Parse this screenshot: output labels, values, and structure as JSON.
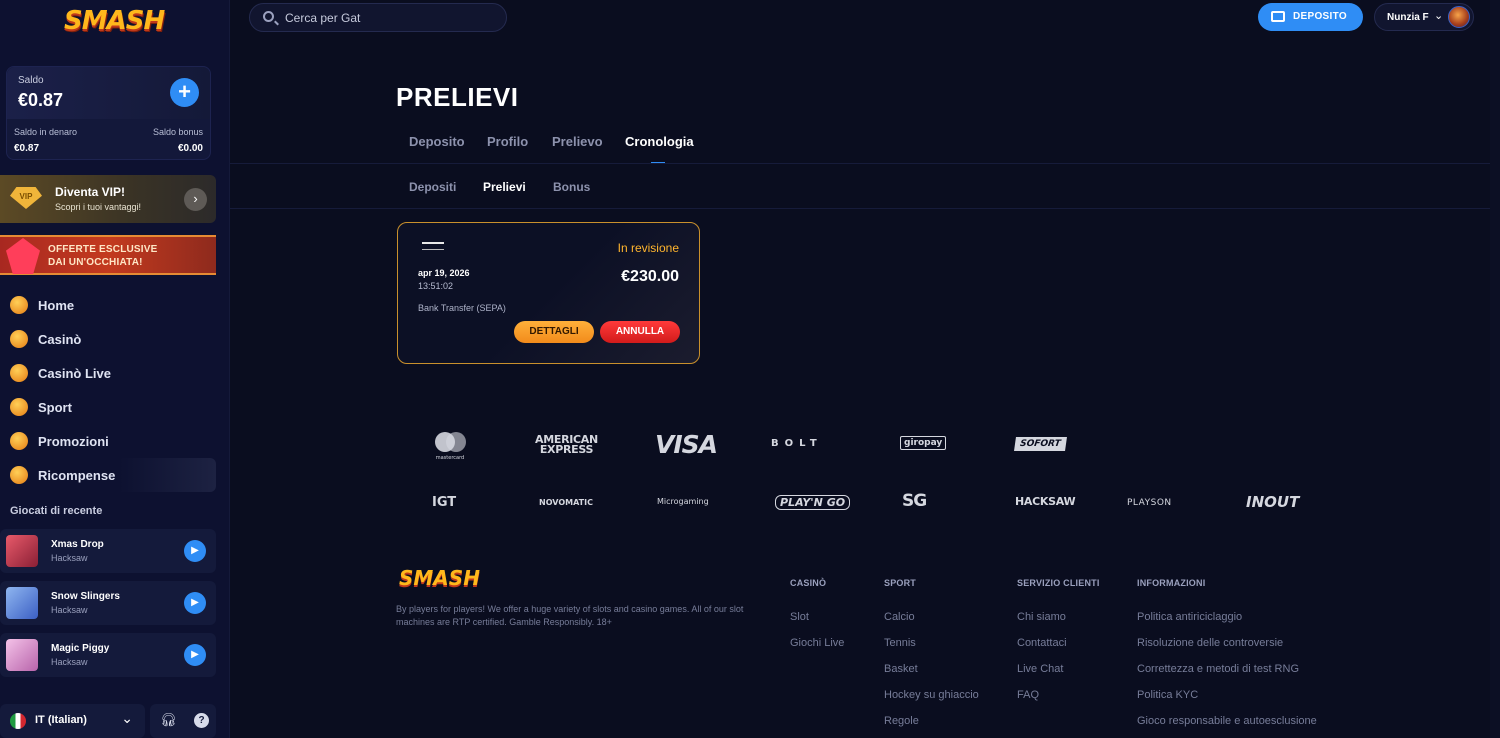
{
  "brand": {
    "logo_text": "SMASH"
  },
  "header": {
    "search_placeholder": "Cerca per Gat",
    "deposit_label": "DEPOSITO",
    "user_name": "Nunzia F"
  },
  "sidebar": {
    "balance": {
      "label": "Saldo",
      "value": "€0.87",
      "cash_label": "Saldo in denaro",
      "cash_value": "€0.87",
      "bonus_label": "Saldo bonus",
      "bonus_value": "€0.00"
    },
    "vip": {
      "badge": "VIP",
      "title": "Diventa VIP!",
      "subtitle": "Scopri i tuoi vantaggi!"
    },
    "promo": {
      "line1": "OFFERTE ESCLUSIVE",
      "line2": "DAI UN'OCCHIATA!"
    },
    "nav": [
      {
        "label": "Home",
        "icon": "home-icon"
      },
      {
        "label": "Casinò",
        "icon": "spade-icon"
      },
      {
        "label": "Casinò Live",
        "icon": "dice-icon"
      },
      {
        "label": "Sport",
        "icon": "ball-icon"
      },
      {
        "label": "Promozioni",
        "icon": "promo-icon"
      },
      {
        "label": "Ricompense",
        "icon": "medal-icon"
      }
    ],
    "recent_title": "Giocati di recente",
    "recent": [
      {
        "name": "Xmas Drop",
        "provider": "Hacksaw",
        "color": "#c23b4d"
      },
      {
        "name": "Snow Slingers",
        "provider": "Hacksaw",
        "color": "#5b7fd6"
      },
      {
        "name": "Magic Piggy",
        "provider": "Hacksaw",
        "color": "#d9a2d3"
      }
    ],
    "language": "IT (Italian)"
  },
  "main": {
    "title": "PRELIEVI",
    "tabs": [
      "Deposito",
      "Profilo",
      "Prelievo",
      "Cronologia"
    ],
    "active_tab": "Cronologia",
    "subtabs": [
      "Depositi",
      "Prelievi",
      "Bonus"
    ],
    "active_subtab": "Prelievi",
    "withdrawal": {
      "status": "In revisione",
      "date": "apr 19, 2026",
      "time": "13:51:02",
      "amount": "€230.00",
      "method": "Bank Transfer (SEPA)",
      "details_label": "DETTAGLI",
      "cancel_label": "ANNULLA"
    }
  },
  "payment_logos": [
    "mastercard",
    "AMERICAN",
    "EXPRESS",
    "VISA",
    "BOLT",
    "giropay",
    "SOFORT"
  ],
  "provider_logos": [
    "IGT",
    "NOVOMATIC",
    "Microgaming",
    "PLAY'N GO",
    "SG",
    "HACKSAW",
    "PLAYSON",
    "INOUT"
  ],
  "footer": {
    "description": "By players for players! We offer a huge variety of slots and casino games. All of our slot machines are RTP certified. Gamble Responsibly. 18+",
    "columns": [
      {
        "title": "CASINÒ",
        "links": [
          "Slot",
          "Giochi Live"
        ]
      },
      {
        "title": "SPORT",
        "links": [
          "Calcio",
          "Tennis",
          "Basket",
          "Hockey su ghiaccio",
          "Regole"
        ]
      },
      {
        "title": "SERVIZIO CLIENTI",
        "links": [
          "Chi siamo",
          "Contattaci",
          "Live Chat",
          "FAQ"
        ]
      },
      {
        "title": "INFORMAZIONI",
        "links": [
          "Politica antiriciclaggio",
          "Risoluzione delle controversie",
          "Correttezza e metodi di test RNG",
          "Politica KYC",
          "Gioco responsabile e autoesclusione"
        ]
      }
    ]
  }
}
